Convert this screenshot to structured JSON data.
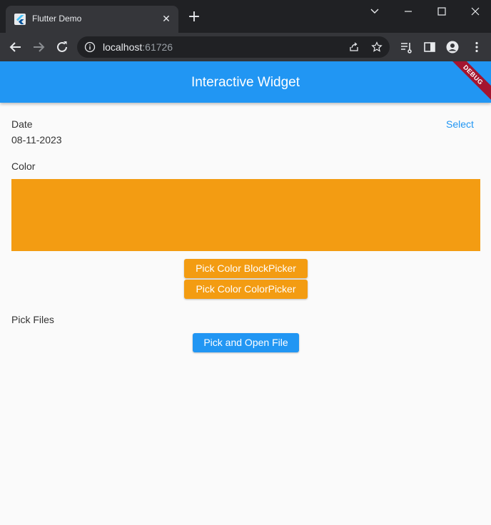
{
  "browser": {
    "tab_title": "Flutter Demo",
    "new_tab": "+",
    "url_host": "localhost",
    "url_port": ":61726"
  },
  "app": {
    "title": "Interactive Widget",
    "debug_banner": "DEBUG",
    "date_label": "Date",
    "date_value": "08-11-2023",
    "select_label": "Select",
    "color_label": "Color",
    "selected_color": "#f39c12",
    "pick_block_label": "Pick Color BlockPicker",
    "pick_color_label": "Pick Color ColorPicker",
    "pick_files_label": "Pick Files",
    "pick_open_label": "Pick and Open File"
  },
  "colors": {
    "appbar": "#2196f3",
    "accent": "#2196f3",
    "orange": "#f39c12"
  }
}
